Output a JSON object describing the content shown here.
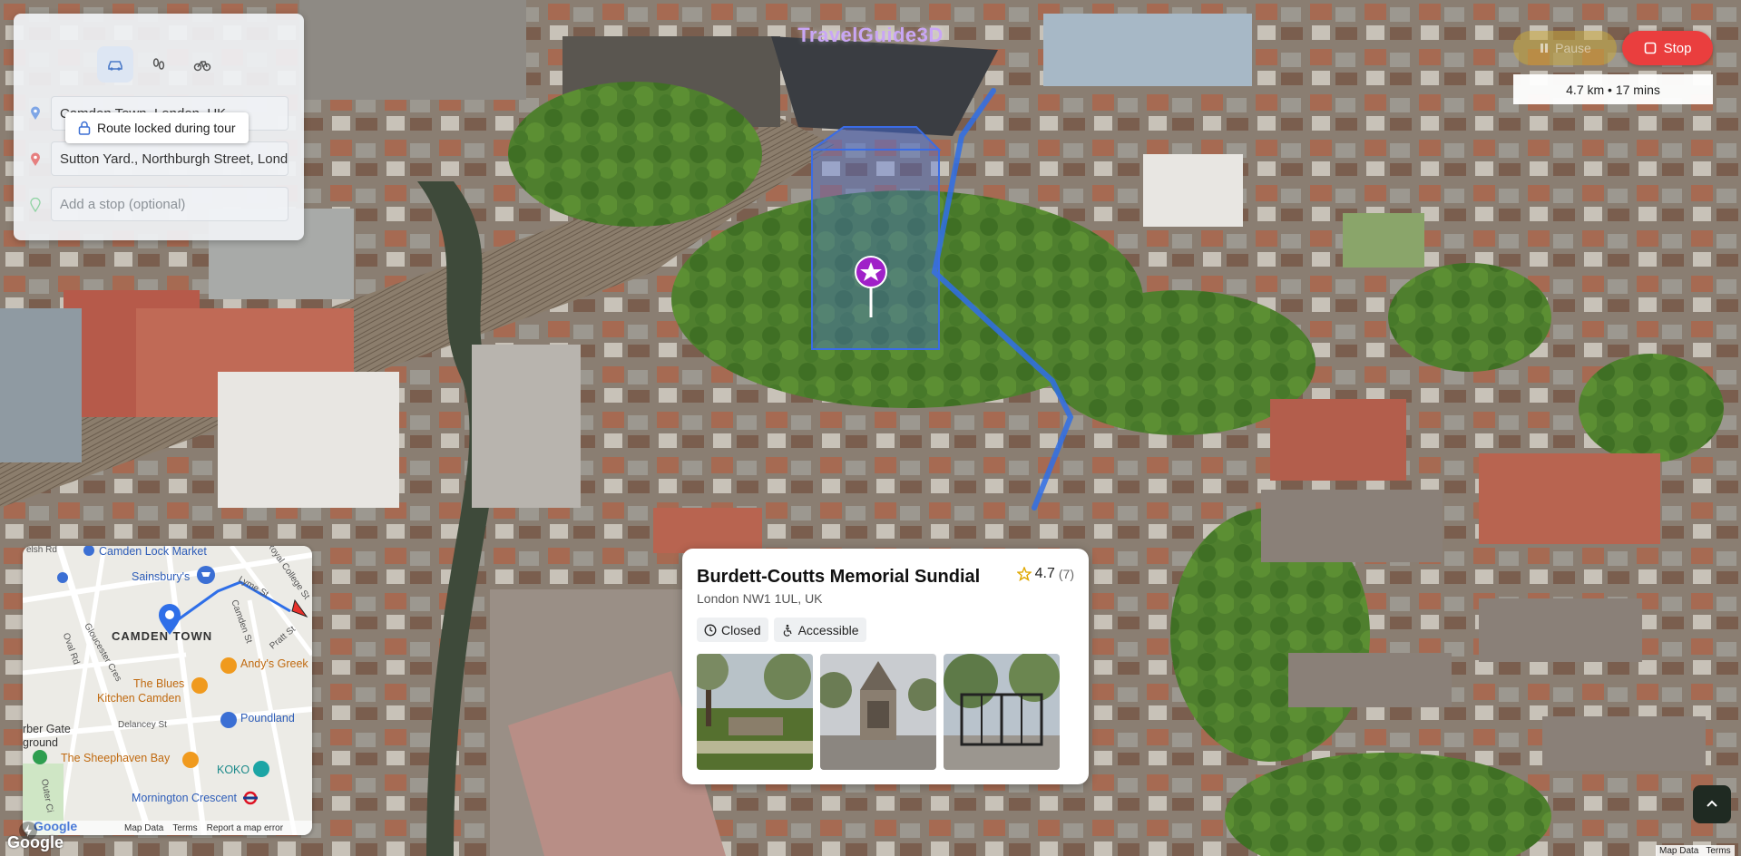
{
  "app": {
    "title": "TravelGuide3D"
  },
  "route": {
    "modes": [
      {
        "name": "driving",
        "icon": "car-icon",
        "active": true
      },
      {
        "name": "walking",
        "icon": "footprints-icon",
        "active": false
      },
      {
        "name": "cycling",
        "icon": "bicycle-icon",
        "active": false
      }
    ],
    "origin_value": "Camden Town, London, UK",
    "destination_value": "Sutton Yard., Northburgh Street, London",
    "stop_placeholder": "Add a stop (optional)",
    "lock_tooltip": "Route locked during tour"
  },
  "tour_controls": {
    "pause_label": "Pause",
    "stop_label": "Stop",
    "distance_text": "4.7 km • 17 mins"
  },
  "poi": {
    "name": "Burdett-Coutts Memorial Sundial",
    "address": "London NW1 1UL, UK",
    "rating": "4.7",
    "rating_count": "(7)",
    "chips": [
      {
        "icon": "clock-icon",
        "label": "Closed"
      },
      {
        "icon": "accessible-icon",
        "label": "Accessible"
      }
    ],
    "photos": [
      "photo-garden",
      "photo-monument",
      "photo-gate"
    ]
  },
  "minimap": {
    "labels": {
      "camden_lock": "Camden Lock Market",
      "sainsburys": "Sainsbury's",
      "camden_town": "CAMDEN TOWN",
      "andys": "Andy's Greek",
      "blues_kitchen_1": "The Blues",
      "blues_kitchen_2": "Kitchen Camden",
      "poundland": "Poundland",
      "sheephaven": "The Sheephaven Bay",
      "koko": "KOKO",
      "mornington": "Mornington Crescent",
      "harber_gate_1": "rber Gate",
      "harber_gate_2": "ground",
      "delancey": "Delancey St",
      "camden_st": "Camden St",
      "pratt_st": "Pratt St",
      "royal_college": "Royal College St",
      "lyme_st": "Lyme St",
      "oval_rd": "Oval Rd",
      "gloucester": "Gloucester Cres",
      "outer_circle": "Outer Ci",
      "top_left": "elsh Rd"
    },
    "footer": {
      "map_data": "Map Data",
      "terms": "Terms",
      "report": "Report a map error"
    },
    "google": "Google"
  },
  "footer": {
    "google": "Google",
    "map_data": "Map Data",
    "terms": "Terms"
  },
  "colors": {
    "accent": "#ea3e3e",
    "title": "#c9a6f5",
    "route_blue": "#2f6fe8",
    "marker": "#a020c8"
  }
}
